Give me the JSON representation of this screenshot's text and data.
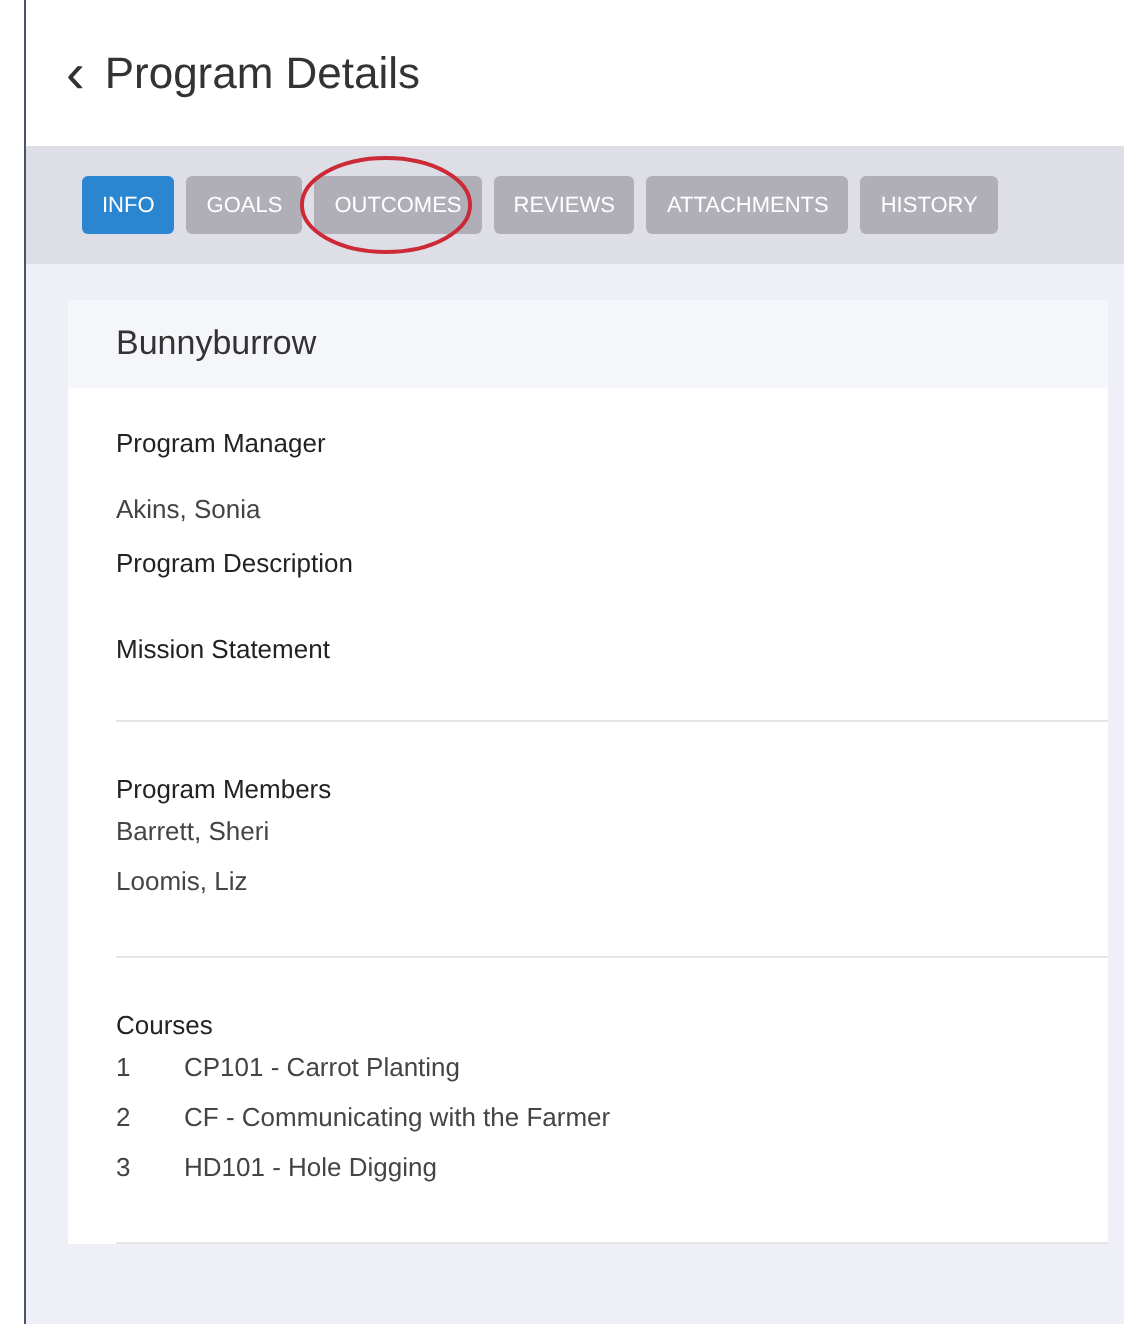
{
  "header": {
    "back_icon": "‹",
    "title": "Program Details"
  },
  "tabs": [
    {
      "label": "INFO",
      "selected": true,
      "circled": false
    },
    {
      "label": "GOALS",
      "selected": false,
      "circled": false
    },
    {
      "label": "OUTCOMES",
      "selected": false,
      "circled": true
    },
    {
      "label": "REVIEWS",
      "selected": false,
      "circled": false
    },
    {
      "label": "ATTACHMENTS",
      "selected": false,
      "circled": false
    },
    {
      "label": "HISTORY",
      "selected": false,
      "circled": false
    }
  ],
  "card": {
    "title": "Bunnyburrow",
    "fields": [
      {
        "label": "Program Manager",
        "value": "Akins, Sonia"
      },
      {
        "label": "Program Description"
      },
      {
        "label": "Mission Statement"
      }
    ],
    "members": {
      "label": "Program Members",
      "names": [
        "Barrett, Sheri",
        "Loomis, Liz"
      ]
    },
    "courses": {
      "label": "Courses",
      "items": [
        {
          "number": "1",
          "name": "CP101 - Carrot Planting"
        },
        {
          "number": "2",
          "name": "CF - Communicating with the Farmer"
        },
        {
          "number": "3",
          "name": "HD101 - Hole Digging"
        }
      ]
    }
  }
}
